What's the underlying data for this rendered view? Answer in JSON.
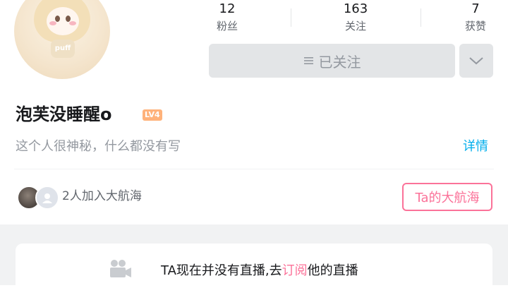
{
  "avatar": {
    "tag_text": "puff"
  },
  "stats": [
    {
      "value": "12",
      "label": "粉丝"
    },
    {
      "value": "163",
      "label": "关注"
    },
    {
      "value": "7",
      "label": "获赞"
    }
  ],
  "follow": {
    "icon": "menu-lines-icon",
    "label": "已关注",
    "more_icon": "chevron-down-icon"
  },
  "profile": {
    "name": "泡芙没睡醒o",
    "level": "LV4",
    "bio": "这个人很神秘，什么都没有写",
    "detail_link": "详情"
  },
  "crew": {
    "text": "2人加入大航海",
    "button": "Ta的大航海"
  },
  "live": {
    "text_before": "TA现在并没有直播,去",
    "link": "订阅",
    "text_after": "他的直播"
  },
  "colors": {
    "accent_pink": "#fb7299",
    "link_blue": "#00aeec",
    "level_orange": "#ffb27a",
    "button_gray": "#e3e5e7"
  }
}
